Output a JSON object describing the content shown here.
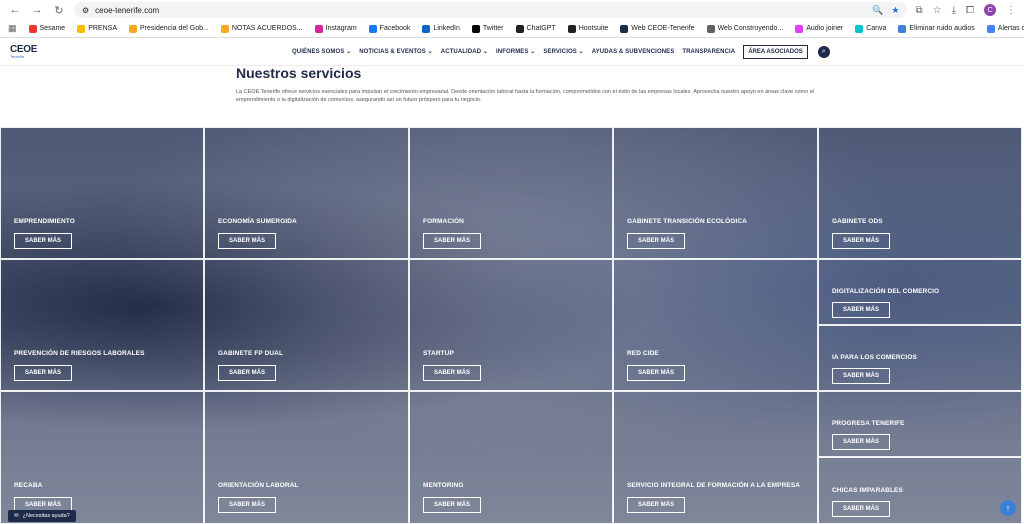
{
  "browser": {
    "url": "ceoe-tenerife.com",
    "bookmarks": [
      {
        "label": "Sesame",
        "color": "#e53935"
      },
      {
        "label": "PRENSA",
        "color": "#fbbc04"
      },
      {
        "label": "Presidencia del Gob...",
        "color": "#f9a825"
      },
      {
        "label": "NOTAS ACUERDOS...",
        "color": "#f9a825"
      },
      {
        "label": "Instagram",
        "color": "#d6249f"
      },
      {
        "label": "Facebook",
        "color": "#1877f2"
      },
      {
        "label": "LinkedIn",
        "color": "#0a66c2"
      },
      {
        "label": "Twitter",
        "color": "#000000"
      },
      {
        "label": "ChatGPT",
        "color": "#202124"
      },
      {
        "label": "Hootsuite",
        "color": "#202124"
      },
      {
        "label": "Web CEOE-Tenerife",
        "color": "#1e2a4a"
      },
      {
        "label": "Web Construyendo...",
        "color": "#5f6368"
      },
      {
        "label": "Audio joiner",
        "color": "#e040fb"
      },
      {
        "label": "Canva",
        "color": "#00c4cc"
      },
      {
        "label": "Eliminar ruido audios",
        "color": "#3b82d6"
      },
      {
        "label": "Alertas de Google",
        "color": "#4285f4"
      }
    ],
    "profile_initial": "C"
  },
  "site": {
    "logo_main": "CEOE",
    "logo_sub": "Tenerife",
    "menu": [
      "QUIÉNES SOMOS ⌄",
      "NOTICIAS & EVENTOS ⌄",
      "ACTUALIDAD ⌄",
      "INFORMES ⌄",
      "SERVICIOS ⌄",
      "AYUDAS & SUBVENCIONES",
      "TRANSPARENCIA"
    ],
    "associates": "ÁREA ASOCIADOS"
  },
  "intro": {
    "title": "Nuestros servicios",
    "text": "La CEOE Tenerife ofrece servicios esenciales para impulsar el crecimiento empresarial. Desde orientación laboral hasta la formación, comprometidos con el éxito de las empresas locales. Aprovecha nuestro apoyo en áreas clave como el emprendimiento o la digitalización de comercios, asegurando así un futuro próspero para tu negocio."
  },
  "services": [
    {
      "title": "EMPRENDIMIENTO",
      "button": "SABER MÁS"
    },
    {
      "title": "ECONOMÍA SUMERGIDA",
      "button": "SABER MÁS"
    },
    {
      "title": "FORMACIÓN",
      "button": "SABER MÁS"
    },
    {
      "title": "GABINETE TRANSICIÓN ECOLÓGICA",
      "button": "SABER MÁS"
    },
    {
      "title": "GABINETE ODS",
      "button": "SABER MÁS"
    },
    {
      "title": "DIGITALIZACIÓN DEL COMERCIO",
      "button": "SABER MÁS"
    },
    {
      "title": "PREVENCIÓN DE RIESGOS LABORALES",
      "button": "SABER MÁS"
    },
    {
      "title": "GABINETE FP DUAL",
      "button": "SABER MÁS"
    },
    {
      "title": "STARTUP",
      "button": "SABER MÁS"
    },
    {
      "title": "RED CIDE",
      "button": "SABER MÁS"
    },
    {
      "title": "IA PARA LOS COMERCIOS",
      "button": "SABER MÁS"
    },
    {
      "title": "PROGRESA TENERIFE",
      "button": "SABER MÁS"
    },
    {
      "title": "RECABA",
      "button": "SABER MÁS"
    },
    {
      "title": "ORIENTACIÓN LABORAL",
      "button": "SABER MÁS"
    },
    {
      "title": "MENTORING",
      "button": "SABER MÁS"
    },
    {
      "title": "SERVICIO INTEGRAL DE FORMACIÓN A LA EMPRESA",
      "button": "SABER MÁS"
    },
    {
      "title": "CHICAS IMPARABLES",
      "button": "SABER MÁS"
    }
  ],
  "help_label": "¿Necesitas ayuda?"
}
